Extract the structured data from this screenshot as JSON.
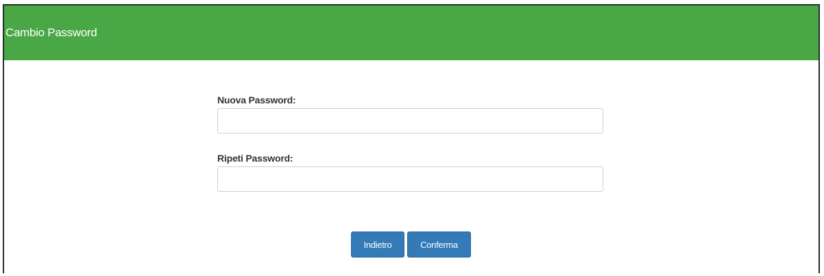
{
  "panel": {
    "title": "Cambio Password"
  },
  "form": {
    "new_password": {
      "label": "Nuova Password:",
      "value": "",
      "placeholder": ""
    },
    "repeat_password": {
      "label": "Ripeti Password:",
      "value": "",
      "placeholder": ""
    }
  },
  "actions": {
    "back_label": "Indietro",
    "confirm_label": "Conferma"
  },
  "colors": {
    "header_bg": "#49a745",
    "button_bg": "#337ab7"
  }
}
